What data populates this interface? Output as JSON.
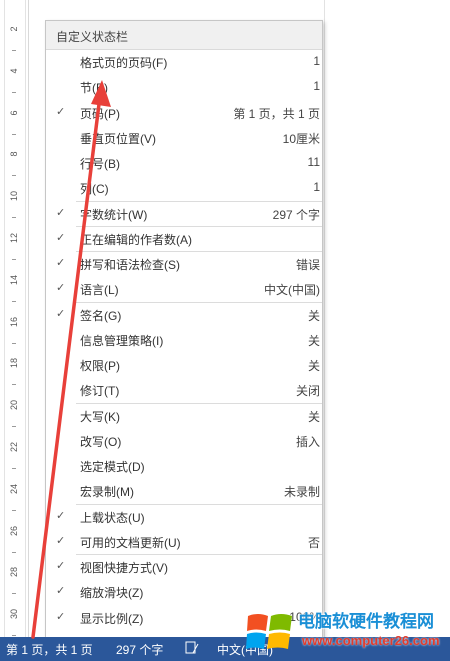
{
  "ruler": {
    "numbers": [
      "2",
      "4",
      "6",
      "8",
      "10",
      "12",
      "14",
      "16",
      "18",
      "20",
      "22",
      "24",
      "26",
      "28",
      "30"
    ]
  },
  "menu": {
    "title": "自定义状态栏",
    "items": [
      {
        "checked": false,
        "label": "格式页的页码(F)",
        "value": "1"
      },
      {
        "checked": false,
        "label": "节(E)",
        "value": "1"
      },
      {
        "checked": true,
        "label": "页码(P)",
        "value": "第 1 页，共 1 页"
      },
      {
        "checked": false,
        "label": "垂直页位置(V)",
        "value": "10厘米"
      },
      {
        "checked": false,
        "label": "行号(B)",
        "value": "11"
      },
      {
        "checked": false,
        "label": "列(C)",
        "value": "1"
      },
      {
        "checked": true,
        "label": "字数统计(W)",
        "value": "297 个字"
      },
      {
        "checked": true,
        "label": "正在编辑的作者数(A)",
        "value": ""
      },
      {
        "checked": true,
        "label": "拼写和语法检查(S)",
        "value": "错误"
      },
      {
        "checked": true,
        "label": "语言(L)",
        "value": "中文(中国)"
      },
      {
        "checked": true,
        "label": "签名(G)",
        "value": "关"
      },
      {
        "checked": false,
        "label": "信息管理策略(I)",
        "value": "关"
      },
      {
        "checked": false,
        "label": "权限(P)",
        "value": "关"
      },
      {
        "checked": false,
        "label": "修订(T)",
        "value": "关闭"
      },
      {
        "checked": false,
        "label": "大写(K)",
        "value": "关"
      },
      {
        "checked": false,
        "label": "改写(O)",
        "value": "插入"
      },
      {
        "checked": false,
        "label": "选定模式(D)",
        "value": ""
      },
      {
        "checked": false,
        "label": "宏录制(M)",
        "value": "未录制"
      },
      {
        "checked": true,
        "label": "上载状态(U)",
        "value": ""
      },
      {
        "checked": true,
        "label": "可用的文档更新(U)",
        "value": "否"
      },
      {
        "checked": true,
        "label": "视图快捷方式(V)",
        "value": ""
      },
      {
        "checked": true,
        "label": "缩放滑块(Z)",
        "value": ""
      },
      {
        "checked": true,
        "label": "显示比例(Z)",
        "value": "100%"
      }
    ],
    "check_glyph": "✓"
  },
  "statusbar": {
    "page": "第 1 页，共 1 页",
    "words": "297 个字",
    "proofing_icon": "proofing-icon",
    "language": "中文(中国)"
  },
  "watermark": {
    "line1": "电脑软硬件教程网",
    "line2": "www.computer26.com"
  },
  "colors": {
    "statusbar": "#2b579a",
    "arrow": "#e8403a"
  }
}
